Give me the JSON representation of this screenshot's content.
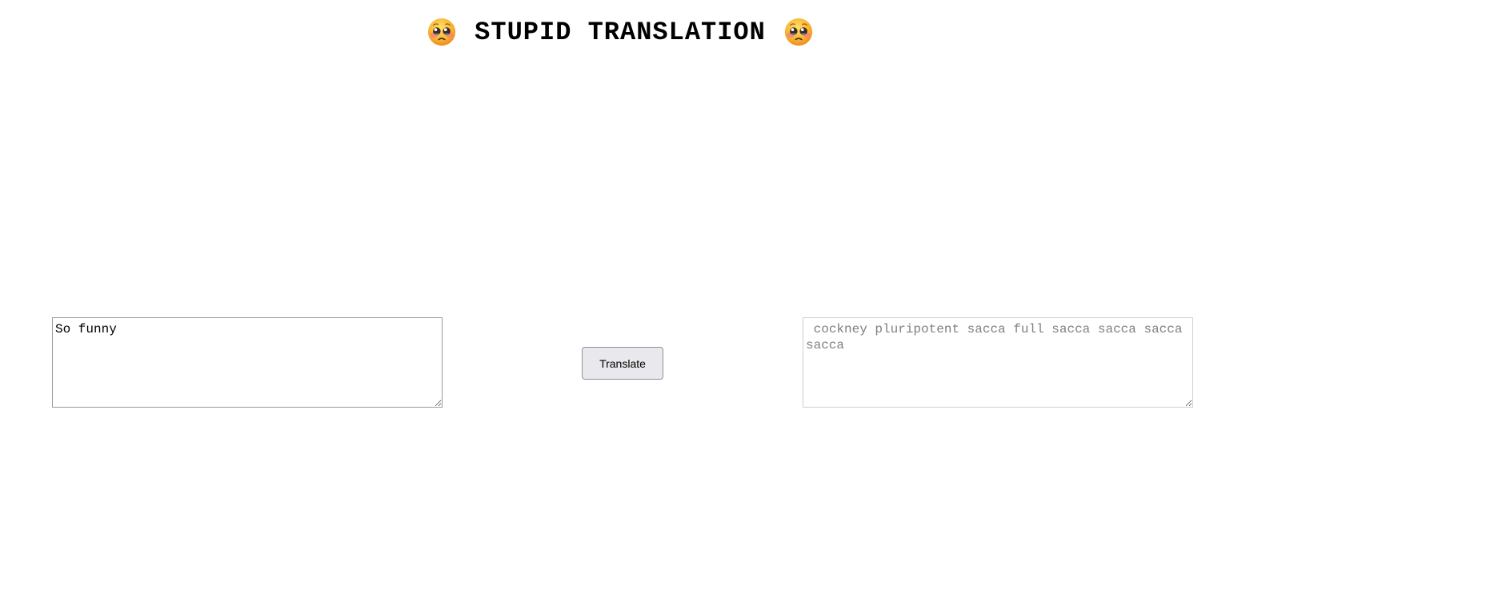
{
  "header": {
    "title": "STUPID TRANSLATION",
    "left_emoji": "pleading-face-icon",
    "right_emoji": "pleading-face-icon"
  },
  "input": {
    "value": "So funny"
  },
  "translate_button": {
    "label": "Translate"
  },
  "output": {
    "value": " cockney pluripotent sacca full sacca sacca sacca sacca"
  }
}
